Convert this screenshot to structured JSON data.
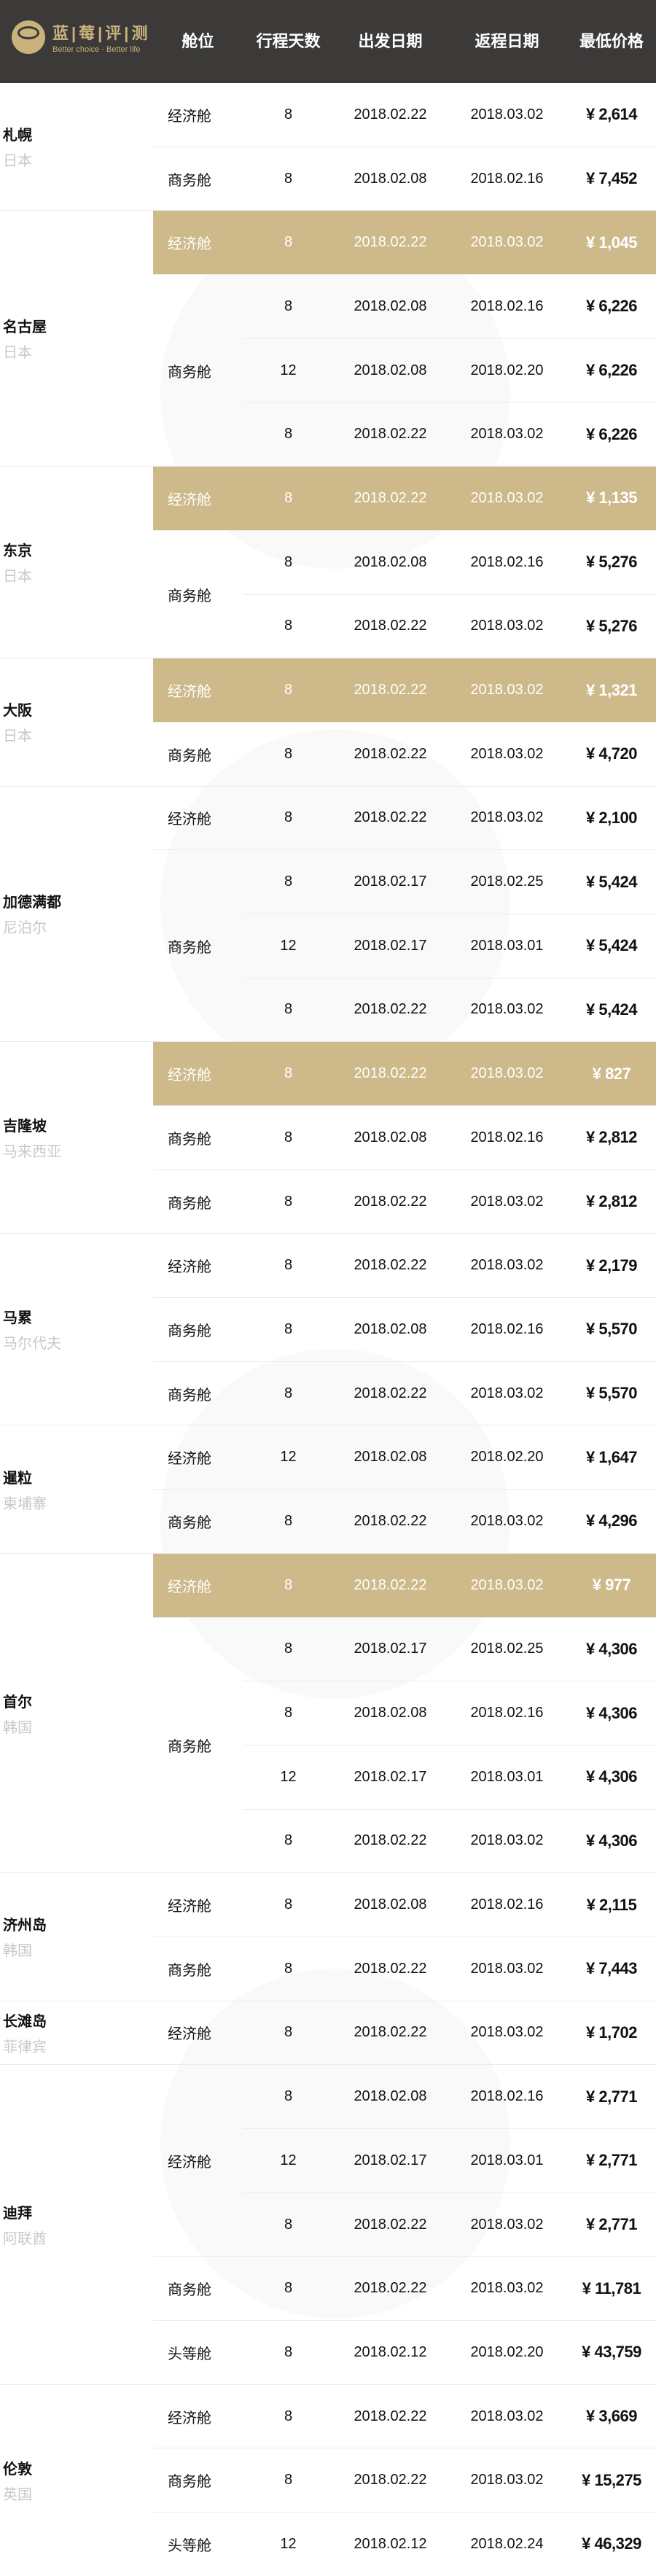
{
  "header": {
    "logo_cn": "蓝|莓|评|测",
    "logo_en": "Better choice · Better life",
    "columns": [
      "舱位",
      "行程天数",
      "出发日期",
      "返程日期",
      "最低价格"
    ]
  },
  "colors": {
    "header_bg": "#3b3a39",
    "highlight": "#cdb98a",
    "brand_gold": "#c9b27c"
  },
  "cities": [
    {
      "city": "札幌",
      "country": "日本",
      "cabins": [
        {
          "cabin": "经济舱",
          "rows": [
            {
              "days": "8",
              "depart": "2018.02.22",
              "return": "2018.03.02",
              "price": "¥ 2,614"
            }
          ]
        },
        {
          "cabin": "商务舱",
          "rows": [
            {
              "days": "8",
              "depart": "2018.02.08",
              "return": "2018.02.16",
              "price": "¥ 7,452"
            }
          ]
        }
      ]
    },
    {
      "city": "名古屋",
      "country": "日本",
      "cabins": [
        {
          "cabin": "经济舱",
          "highlight": true,
          "rows": [
            {
              "days": "8",
              "depart": "2018.02.22",
              "return": "2018.03.02",
              "price": "¥ 1,045"
            }
          ]
        },
        {
          "cabin": "商务舱",
          "rows": [
            {
              "days": "8",
              "depart": "2018.02.08",
              "return": "2018.02.16",
              "price": "¥ 6,226"
            },
            {
              "days": "12",
              "depart": "2018.02.08",
              "return": "2018.02.20",
              "price": "¥ 6,226"
            },
            {
              "days": "8",
              "depart": "2018.02.22",
              "return": "2018.03.02",
              "price": "¥ 6,226"
            }
          ]
        }
      ]
    },
    {
      "city": "东京",
      "country": "日本",
      "cabins": [
        {
          "cabin": "经济舱",
          "highlight": true,
          "rows": [
            {
              "days": "8",
              "depart": "2018.02.22",
              "return": "2018.03.02",
              "price": "¥ 1,135"
            }
          ]
        },
        {
          "cabin": "商务舱",
          "rows": [
            {
              "days": "8",
              "depart": "2018.02.08",
              "return": "2018.02.16",
              "price": "¥ 5,276"
            },
            {
              "days": "8",
              "depart": "2018.02.22",
              "return": "2018.03.02",
              "price": "¥ 5,276"
            }
          ]
        }
      ]
    },
    {
      "city": "大阪",
      "country": "日本",
      "cabins": [
        {
          "cabin": "经济舱",
          "highlight": true,
          "rows": [
            {
              "days": "8",
              "depart": "2018.02.22",
              "return": "2018.03.02",
              "price": "¥ 1,321"
            }
          ]
        },
        {
          "cabin": "商务舱",
          "rows": [
            {
              "days": "8",
              "depart": "2018.02.22",
              "return": "2018.03.02",
              "price": "¥ 4,720"
            }
          ]
        }
      ]
    },
    {
      "city": "加德满都",
      "country": "尼泊尔",
      "cabins": [
        {
          "cabin": "经济舱",
          "rows": [
            {
              "days": "8",
              "depart": "2018.02.22",
              "return": "2018.03.02",
              "price": "¥ 2,100"
            }
          ]
        },
        {
          "cabin": "商务舱",
          "rows": [
            {
              "days": "8",
              "depart": "2018.02.17",
              "return": "2018.02.25",
              "price": "¥ 5,424"
            },
            {
              "days": "12",
              "depart": "2018.02.17",
              "return": "2018.03.01",
              "price": "¥ 5,424"
            },
            {
              "days": "8",
              "depart": "2018.02.22",
              "return": "2018.03.02",
              "price": "¥ 5,424"
            }
          ]
        }
      ]
    },
    {
      "city": "吉隆坡",
      "country": "马来西亚",
      "cabins": [
        {
          "cabin": "经济舱",
          "highlight": true,
          "rows": [
            {
              "days": "8",
              "depart": "2018.02.22",
              "return": "2018.03.02",
              "price": "¥ 827"
            }
          ]
        },
        {
          "cabin": "商务舱",
          "rows": [
            {
              "days": "8",
              "depart": "2018.02.08",
              "return": "2018.02.16",
              "price": "¥ 2,812"
            }
          ]
        },
        {
          "cabin": "商务舱",
          "rows": [
            {
              "days": "8",
              "depart": "2018.02.22",
              "return": "2018.03.02",
              "price": "¥ 2,812"
            }
          ]
        }
      ]
    },
    {
      "city": "马累",
      "country": "马尔代夫",
      "cabins": [
        {
          "cabin": "经济舱",
          "rows": [
            {
              "days": "8",
              "depart": "2018.02.22",
              "return": "2018.03.02",
              "price": "¥ 2,179"
            }
          ]
        },
        {
          "cabin": "商务舱",
          "rows": [
            {
              "days": "8",
              "depart": "2018.02.08",
              "return": "2018.02.16",
              "price": "¥ 5,570"
            }
          ]
        },
        {
          "cabin": "商务舱",
          "rows": [
            {
              "days": "8",
              "depart": "2018.02.22",
              "return": "2018.03.02",
              "price": "¥ 5,570"
            }
          ]
        }
      ]
    },
    {
      "city": "暹粒",
      "country": "柬埔寨",
      "cabins": [
        {
          "cabin": "经济舱",
          "rows": [
            {
              "days": "12",
              "depart": "2018.02.08",
              "return": "2018.02.20",
              "price": "¥ 1,647"
            }
          ]
        },
        {
          "cabin": "商务舱",
          "rows": [
            {
              "days": "8",
              "depart": "2018.02.22",
              "return": "2018.03.02",
              "price": "¥ 4,296"
            }
          ]
        }
      ]
    },
    {
      "city": "首尔",
      "country": "韩国",
      "cabins": [
        {
          "cabin": "经济舱",
          "highlight": true,
          "rows": [
            {
              "days": "8",
              "depart": "2018.02.22",
              "return": "2018.03.02",
              "price": "¥ 977"
            }
          ]
        },
        {
          "cabin": "商务舱",
          "rows": [
            {
              "days": "8",
              "depart": "2018.02.17",
              "return": "2018.02.25",
              "price": "¥ 4,306"
            },
            {
              "days": "8",
              "depart": "2018.02.08",
              "return": "2018.02.16",
              "price": "¥ 4,306"
            },
            {
              "days": "12",
              "depart": "2018.02.17",
              "return": "2018.03.01",
              "price": "¥ 4,306"
            },
            {
              "days": "8",
              "depart": "2018.02.22",
              "return": "2018.03.02",
              "price": "¥ 4,306"
            }
          ]
        }
      ]
    },
    {
      "city": "济州岛",
      "country": "韩国",
      "cabins": [
        {
          "cabin": "经济舱",
          "rows": [
            {
              "days": "8",
              "depart": "2018.02.08",
              "return": "2018.02.16",
              "price": "¥ 2,115"
            }
          ]
        },
        {
          "cabin": "商务舱",
          "rows": [
            {
              "days": "8",
              "depart": "2018.02.22",
              "return": "2018.03.02",
              "price": "¥ 7,443"
            }
          ]
        }
      ]
    },
    {
      "city": "长滩岛",
      "country": "菲律宾",
      "cabins": [
        {
          "cabin": "经济舱",
          "rows": [
            {
              "days": "8",
              "depart": "2018.02.22",
              "return": "2018.03.02",
              "price": "¥ 1,702"
            }
          ]
        }
      ]
    },
    {
      "city": "迪拜",
      "country": "阿联酋",
      "cabins": [
        {
          "cabin": "经济舱",
          "rows": [
            {
              "days": "8",
              "depart": "2018.02.08",
              "return": "2018.02.16",
              "price": "¥ 2,771"
            },
            {
              "days": "12",
              "depart": "2018.02.17",
              "return": "2018.03.01",
              "price": "¥ 2,771"
            },
            {
              "days": "8",
              "depart": "2018.02.22",
              "return": "2018.03.02",
              "price": "¥ 2,771"
            }
          ]
        },
        {
          "cabin": "商务舱",
          "rows": [
            {
              "days": "8",
              "depart": "2018.02.22",
              "return": "2018.03.02",
              "price": "¥ 11,781"
            }
          ]
        },
        {
          "cabin": "头等舱",
          "rows": [
            {
              "days": "8",
              "depart": "2018.02.12",
              "return": "2018.02.20",
              "price": "¥ 43,759"
            }
          ]
        }
      ]
    },
    {
      "city": "伦敦",
      "country": "英国",
      "cabins": [
        {
          "cabin": "经济舱",
          "rows": [
            {
              "days": "8",
              "depart": "2018.02.22",
              "return": "2018.03.02",
              "price": "¥ 3,669"
            }
          ]
        },
        {
          "cabin": "商务舱",
          "rows": [
            {
              "days": "8",
              "depart": "2018.02.22",
              "return": "2018.03.02",
              "price": "¥ 15,275"
            }
          ]
        },
        {
          "cabin": "头等舱",
          "rows": [
            {
              "days": "12",
              "depart": "2018.02.12",
              "return": "2018.02.24",
              "price": "¥ 46,329"
            }
          ]
        }
      ]
    }
  ]
}
